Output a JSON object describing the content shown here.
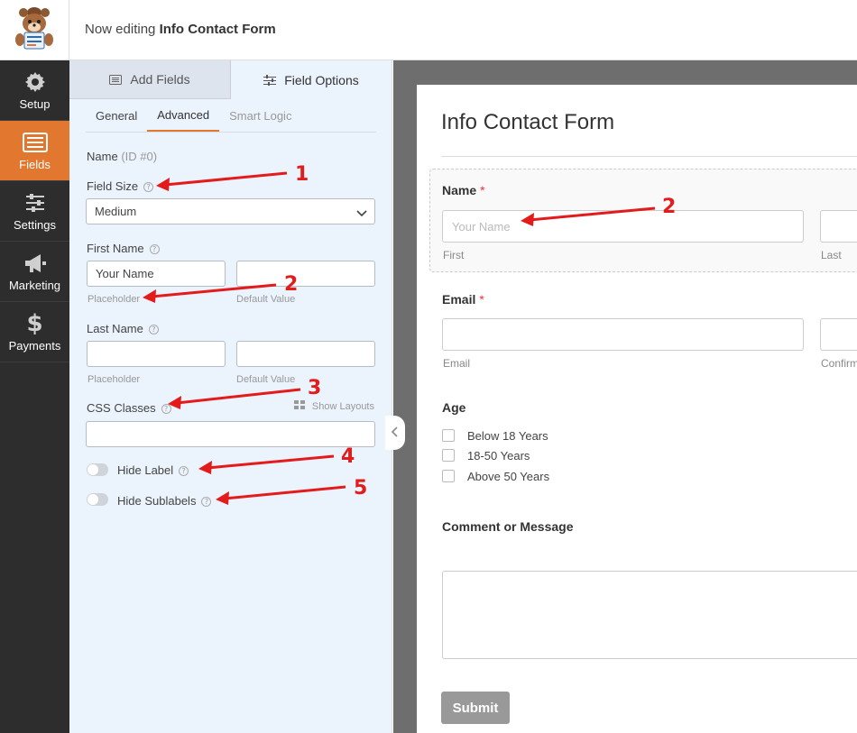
{
  "header": {
    "editing_prefix": "Now editing",
    "form_name": "Info Contact Form"
  },
  "nav": [
    {
      "label": "Setup",
      "icon": "gear-icon"
    },
    {
      "label": "Fields",
      "icon": "fields-list-icon",
      "active": true
    },
    {
      "label": "Settings",
      "icon": "sliders-icon"
    },
    {
      "label": "Marketing",
      "icon": "megaphone-icon"
    },
    {
      "label": "Payments",
      "icon": "dollar-icon"
    }
  ],
  "panel": {
    "tabs": {
      "add_fields": "Add Fields",
      "field_options": "Field Options"
    },
    "subtabs": {
      "general": "General",
      "advanced": "Advanced",
      "smart_logic": "Smart Logic"
    },
    "field_name": "Name",
    "field_id": "(ID #0)",
    "field_size_label": "Field Size",
    "field_size_value": "Medium",
    "first_name_label": "First Name",
    "first_name_placeholder_value": "Your Name",
    "first_name_default_value": "",
    "last_name_label": "Last Name",
    "last_name_placeholder_value": "",
    "last_name_default_value": "",
    "placeholder_sublabel": "Placeholder",
    "default_value_sublabel": "Default Value",
    "css_classes_label": "CSS Classes",
    "css_classes_value": "",
    "show_layouts": "Show Layouts",
    "hide_label": "Hide Label",
    "hide_sublabels": "Hide Sublabels",
    "hide_label_on": false,
    "hide_sublabels_on": false
  },
  "preview": {
    "title": "Info Contact Form",
    "name_label": "Name",
    "required_mark": "*",
    "name_first_placeholder": "Your Name",
    "first_sublabel": "First",
    "last_sublabel": "Last",
    "email_label": "Email",
    "email_sublabel": "Email",
    "confirm_sublabel": "Confirm",
    "age_label": "Age",
    "age_options": [
      "Below 18 Years",
      "18-50 Years",
      "Above 50 Years"
    ],
    "comment_label": "Comment or Message",
    "submit_label": "Submit"
  },
  "annotations": [
    "1",
    "2",
    "3",
    "4",
    "5",
    "2"
  ],
  "colors": {
    "accent": "#e27730",
    "sidebar": "#2d2d2d",
    "panel": "#ebf3fc",
    "arrow": "#e31b1b"
  }
}
